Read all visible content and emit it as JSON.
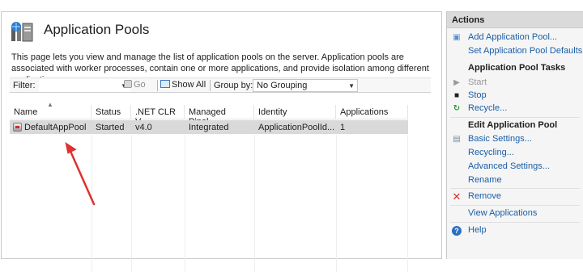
{
  "page": {
    "title": "Application Pools",
    "description": "This page lets you view and manage the list of application pools on the server. Application pools are associated with worker processes, contain one or more applications, and provide isolation among different applications."
  },
  "toolbar": {
    "filter_label": "Filter:",
    "filter_value": "",
    "go_label": "Go",
    "showall_label": "Show All",
    "groupby_label": "Group by:",
    "groupby_value": "No Grouping"
  },
  "table": {
    "columns": [
      "Name",
      "Status",
      ".NET CLR V...",
      "Managed Pipel...",
      "Identity",
      "Applications"
    ],
    "rows": [
      {
        "name": "DefaultAppPool",
        "status": "Started",
        "clr": "v4.0",
        "pipeline": "Integrated",
        "identity": "ApplicationPoolId...",
        "applications": "1"
      }
    ]
  },
  "actions": {
    "title": "Actions",
    "add_pool": "Add Application Pool...",
    "set_defaults": "Set Application Pool Defaults...",
    "tasks_heading": "Application Pool Tasks",
    "start": "Start",
    "stop": "Stop",
    "recycle": "Recycle...",
    "edit_heading": "Edit Application Pool",
    "basic_settings": "Basic Settings...",
    "recycling": "Recycling...",
    "advanced_settings": "Advanced Settings...",
    "rename": "Rename",
    "remove": "Remove",
    "view_applications": "View Applications",
    "help": "Help"
  },
  "colors": {
    "link": "#1a5ea7",
    "selected_row": "#d9d9d9",
    "actions_header": "#dadada",
    "annotation_arrow": "#e03030"
  }
}
